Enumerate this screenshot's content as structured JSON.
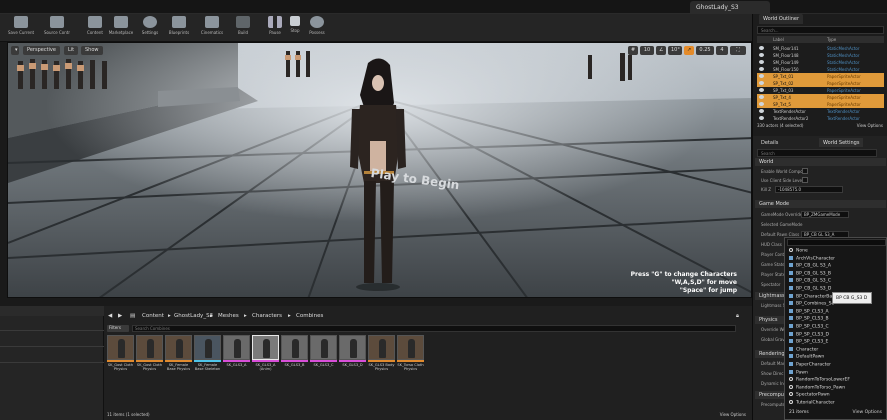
{
  "window": {
    "tab_title": "GhostLady_S3"
  },
  "toolbar": [
    {
      "label": "Save Current",
      "icon": "save-icon"
    },
    {
      "label": "Source Control",
      "icon": "source-control-icon"
    },
    {
      "label": "Content",
      "icon": "content-icon"
    },
    {
      "label": "Marketplace",
      "icon": "marketplace-icon"
    },
    {
      "label": "Settings",
      "icon": "gear-icon"
    },
    {
      "label": "Blueprints",
      "icon": "blueprint-icon"
    },
    {
      "label": "Cinematics",
      "icon": "clapper-icon"
    },
    {
      "label": "Build",
      "icon": "build-icon"
    },
    {
      "label": "Pause",
      "icon": "pause-icon"
    },
    {
      "label": "Stop",
      "icon": "stop-icon"
    },
    {
      "label": "Possess",
      "icon": "possess-icon"
    }
  ],
  "viewport": {
    "perspective": "Perspective",
    "lit": "Lit",
    "show": "Show",
    "snap_grid": "10",
    "snap_angle": "10°",
    "snap_scale": "0.25",
    "camera_speed": "4",
    "floor_text": "Play to Begin",
    "hints": [
      "Press \"G\" to change Characters",
      "\"W,A,S,D\" for move",
      "\"Space\" for jump"
    ]
  },
  "outliner": {
    "tab": "World Outliner",
    "search_placeholder": "Search...",
    "col_label": "Label",
    "col_type": "Type",
    "rows": [
      {
        "label": "SM_Floor141",
        "type": "StaticMeshActor",
        "selected": false
      },
      {
        "label": "SM_Floor148",
        "type": "StaticMeshActor",
        "selected": false
      },
      {
        "label": "SM_Floor149",
        "type": "StaticMeshActor",
        "selected": false
      },
      {
        "label": "SM_Floor150",
        "type": "StaticMeshActor",
        "selected": false
      },
      {
        "label": "SP_Txt_01",
        "type": "PaperSpriteActor",
        "selected": true
      },
      {
        "label": "SP_Txt_02",
        "type": "PaperSpriteActor",
        "selected": true
      },
      {
        "label": "SP_Txt_03",
        "type": "PaperSpriteActor",
        "selected": false
      },
      {
        "label": "SP_Txt_4",
        "type": "PaperSpriteActor",
        "selected": true
      },
      {
        "label": "SP_Txt_5",
        "type": "PaperSpriteActor",
        "selected": true
      },
      {
        "label": "TextRenderActor",
        "type": "TextRenderActor",
        "selected": false
      },
      {
        "label": "TextRenderActor2",
        "type": "TextRenderActor",
        "selected": false
      }
    ],
    "footer": "330 actors (4 selected)",
    "view_options": "View Options"
  },
  "details": {
    "tab_details": "Details",
    "tab_world": "World Settings",
    "search_placeholder": "Search",
    "world_section": "World",
    "world_props": [
      "Enable World Compo",
      "Use Client Side Leve",
      "Kill Z"
    ],
    "kill_z": "-1048575.0",
    "game_mode_section": "Game Mode",
    "game_mode_override_label": "GameMode Override",
    "game_mode_override": "BP_ZMGameMode",
    "selected_game_mode": "Selected GameMode",
    "default_pawn_label": "Default Pawn Class",
    "default_pawn": "BP_CB GL S3_A",
    "other_props": [
      "HUD Class",
      "Player Controller",
      "Game State",
      "Player State",
      "Spectator"
    ],
    "lightmass_section": "Lightmass",
    "lightmass_prop": "Lightmass Se",
    "physics_section": "Physics",
    "physics_props": [
      "Override World",
      "Global Gravity"
    ],
    "rendering_section": "Rendering",
    "rendering_props": [
      "Default Max",
      "Show Direc",
      "Dynamic Ind"
    ],
    "precomputed_section": "Precomputed",
    "precomputed_prop": "Precomputed"
  },
  "dropdown": {
    "items": [
      {
        "label": "None",
        "kind": "circle"
      },
      {
        "label": "ArchVisCharacter",
        "kind": "bp"
      },
      {
        "label": "BP_CB_GL S3_A",
        "kind": "bp"
      },
      {
        "label": "BP_CB_GL S3_B",
        "kind": "bp"
      },
      {
        "label": "BP_CB_GL S3_C",
        "kind": "bp"
      },
      {
        "label": "BP_CB_GL S3_D",
        "kind": "bp"
      },
      {
        "label": "BP_CharacterBase",
        "kind": "bp"
      },
      {
        "label": "BP_Combines_Sc",
        "kind": "bp"
      },
      {
        "label": "BP_SP_CLS3_A",
        "kind": "bp"
      },
      {
        "label": "BP_SP_CLS3_B",
        "kind": "bp"
      },
      {
        "label": "BP_SP_CLS3_C",
        "kind": "bp"
      },
      {
        "label": "BP_SP_CLS3_D",
        "kind": "bp"
      },
      {
        "label": "BP_SP_CLS3_E",
        "kind": "bp"
      },
      {
        "label": "Character",
        "kind": "bp"
      },
      {
        "label": "DefaultPawn",
        "kind": "bp"
      },
      {
        "label": "PaperCharacter",
        "kind": "bp"
      },
      {
        "label": "Pawn",
        "kind": "bp"
      },
      {
        "label": "RandomToTorsoLowerEF",
        "kind": "circle"
      },
      {
        "label": "RandomToTorso_Pawn",
        "kind": "circle"
      },
      {
        "label": "SpectatorPawn",
        "kind": "circle"
      },
      {
        "label": "TutorialCharacter",
        "kind": "circle"
      }
    ],
    "count": "21 items",
    "view_options": "View Options",
    "tooltip": "BP CB G_S3 D"
  },
  "content_browser": {
    "path": [
      "Content",
      "GhostLady_S3",
      "Meshes",
      "Characters",
      "Combines"
    ],
    "filters": "Filters",
    "search_placeholder": "Search Combines",
    "assets": [
      {
        "name": "SK_Gost Cloth Physics",
        "bar": "#e08a2e",
        "selected": false,
        "bg": "#5c4b3c"
      },
      {
        "name": "SK_Gost Cloth Physics",
        "bar": "#e08a2e",
        "selected": false,
        "bg": "#5c4b3c"
      },
      {
        "name": "SK_Female Base Physics",
        "bar": "#e08a2e",
        "selected": false,
        "bg": "#5c4b3c"
      },
      {
        "name": "SK_Female Base Skeleton",
        "bar": "#4fc4e8",
        "selected": false,
        "bg": "#4a5560"
      },
      {
        "name": "SK_GLS3_A",
        "bar": "#d84fd8",
        "selected": false,
        "bg": "#6a6a6a"
      },
      {
        "name": "SK_GLS3_A (Anim)",
        "bar": "#d84fd8",
        "selected": true,
        "bg": "#7a7a7a"
      },
      {
        "name": "SK_GLS3_B",
        "bar": "#d84fd8",
        "selected": false,
        "bg": "#6a6a6a"
      },
      {
        "name": "SK_GLS3_C",
        "bar": "#d84fd8",
        "selected": false,
        "bg": "#6a6a6a"
      },
      {
        "name": "SK_GLS3_D",
        "bar": "#d84fd8",
        "selected": false,
        "bg": "#6a6a6a"
      },
      {
        "name": "SK_GLS3 Body Physics",
        "bar": "#e08a2e",
        "selected": false,
        "bg": "#5c4b3c"
      },
      {
        "name": "SK_Torso Cloth Physics",
        "bar": "#e08a2e",
        "selected": false,
        "bg": "#5c4b3c"
      }
    ],
    "count": "11 items (1 selected)",
    "view_options": "View Options"
  }
}
